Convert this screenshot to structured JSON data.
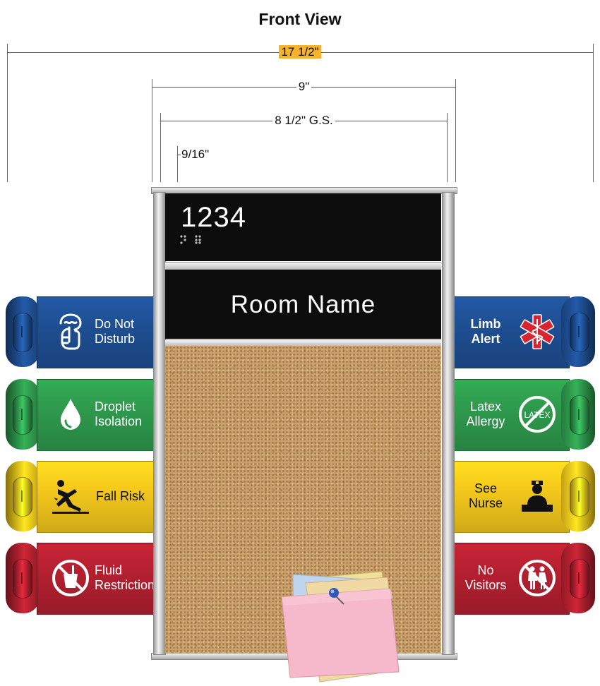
{
  "title": "Front View",
  "dimensions": {
    "overall": "17 1/2\"",
    "sign_width": "9\"",
    "graphic_space": "8 1/2\" G.S.",
    "inset": "9/16\""
  },
  "sign": {
    "room_number": "1234",
    "room_name": "Room Name"
  },
  "flags_left": [
    {
      "lines": [
        "Do Not",
        "Disturb"
      ],
      "icon": "hand-shush-icon",
      "color": "#1e4f93"
    },
    {
      "lines": [
        "Droplet",
        "Isolation"
      ],
      "icon": "droplet-icon",
      "color": "#2e9a4d"
    },
    {
      "lines": [
        "Fall Risk"
      ],
      "icon": "slipping-person-icon",
      "color": "#f4c81c"
    },
    {
      "lines": [
        "Fluid",
        "Restriction"
      ],
      "icon": "no-drink-icon",
      "color": "#b42030"
    }
  ],
  "flags_right": [
    {
      "lines": [
        "Limb",
        "Alert"
      ],
      "icon": "star-of-life-icon",
      "color": "#1e4f93"
    },
    {
      "lines": [
        "Latex",
        "Allergy"
      ],
      "icon": "no-latex-icon",
      "icon_text": "LATEX",
      "color": "#2e9a4d"
    },
    {
      "lines": [
        "See",
        "Nurse"
      ],
      "icon": "nurse-icon",
      "color": "#f4c81c"
    },
    {
      "lines": [
        "No",
        "Visitors"
      ],
      "icon": "no-visitors-icon",
      "color": "#b42030"
    }
  ],
  "colors": {
    "highlight": "#f5b22a",
    "sign_black": "#0c0c0c",
    "cork": "#c9a06a"
  }
}
